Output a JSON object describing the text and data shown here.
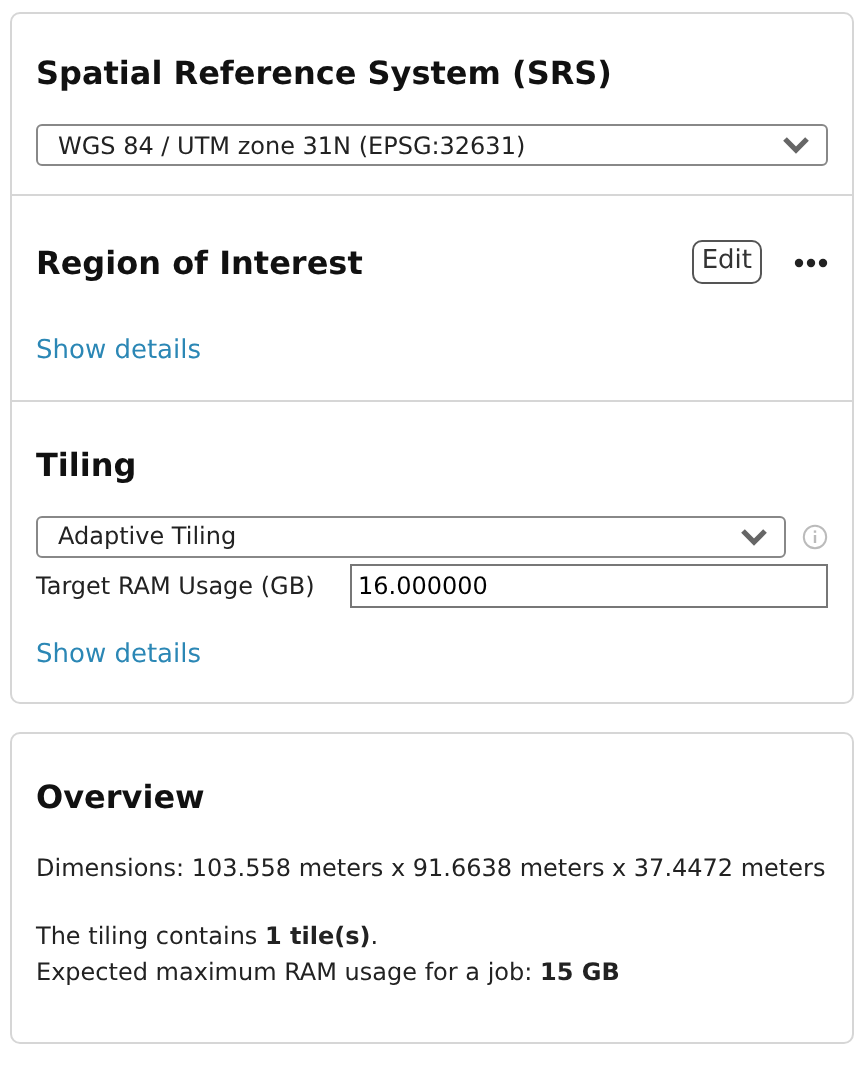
{
  "srs": {
    "title": "Spatial Reference System (SRS)",
    "select": "WGS 84 / UTM zone 31N (EPSG:32631)"
  },
  "roi": {
    "title": "Region of Interest",
    "edit_button": "Edit",
    "link": "Show details"
  },
  "tiling": {
    "title": "Tiling",
    "select": "Adaptive Tiling",
    "field_label": "Target RAM Usage (GB)",
    "field_value": "16.000000",
    "link": "Show details"
  },
  "overview": {
    "title": "Overview",
    "lines": [
      "Dimensions: 103.558 meters x 91.6638 meters x 37.4472 meters",
      "The tiling contains **1 tile(s)**.",
      "Expected maximum RAM usage for a job: **15 GB**"
    ]
  }
}
